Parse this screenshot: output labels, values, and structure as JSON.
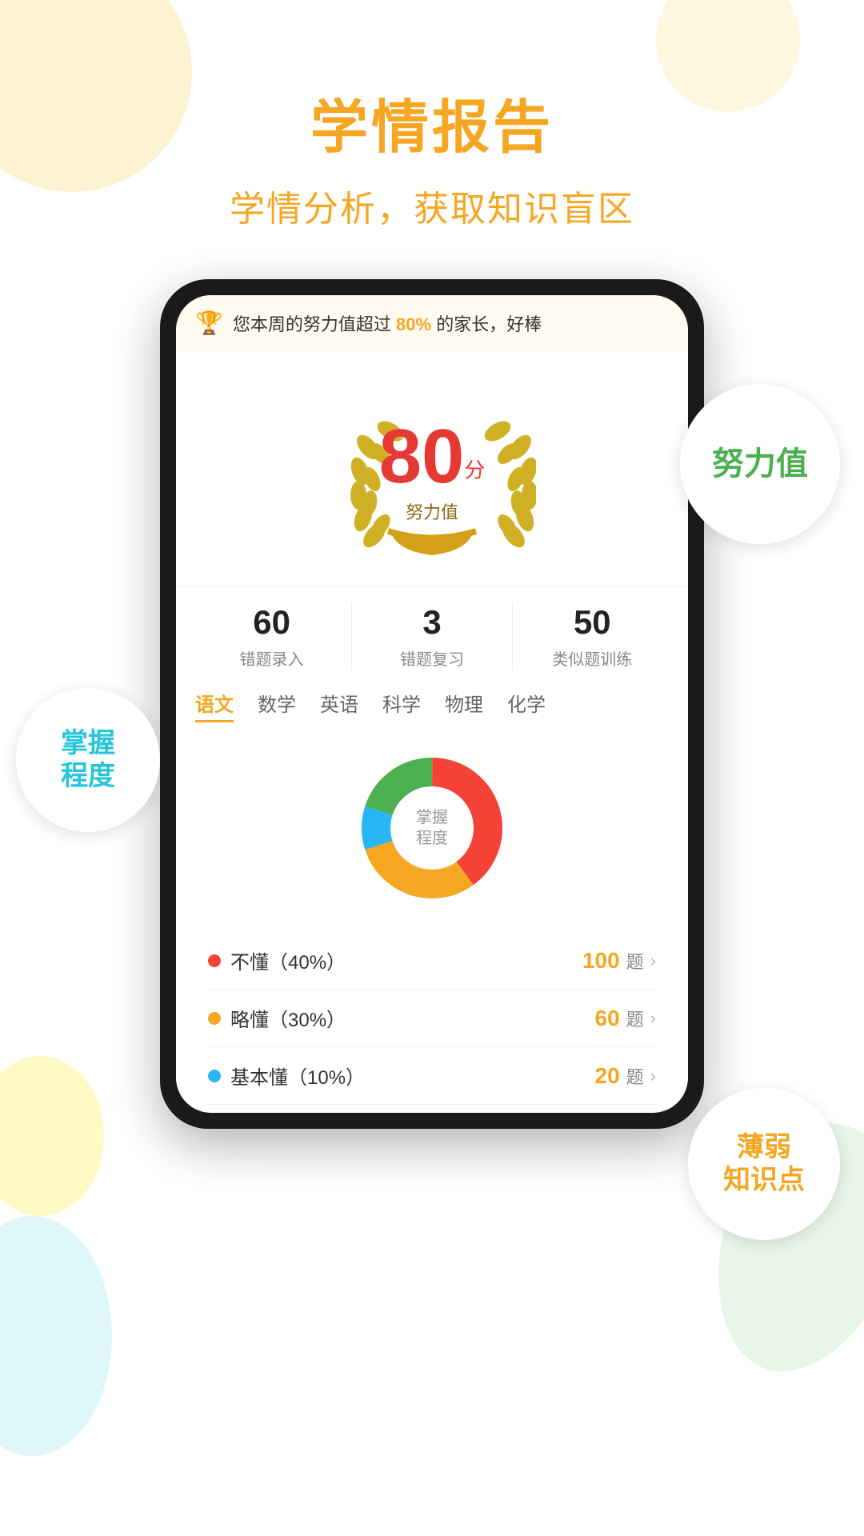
{
  "header": {
    "title": "学情报告",
    "subtitle": "学情分析，获取知识盲区"
  },
  "banner": {
    "text": "您本周的努力值超过",
    "highlight": "80%",
    "suffix": "的家长，好棒"
  },
  "effort": {
    "score": "80",
    "unit": "分",
    "label": "努力值"
  },
  "stats": [
    {
      "number": "60",
      "label": "错题录入"
    },
    {
      "number": "3",
      "label": "错题复习"
    },
    {
      "number": "50",
      "label": "类似题训练"
    }
  ],
  "subjects": [
    "语文",
    "数学",
    "英语",
    "科学",
    "物理",
    "化学"
  ],
  "active_subject": "语文",
  "chart": {
    "center_label": "掌握\n程度",
    "segments": [
      {
        "label": "不懂",
        "color": "#f44336",
        "percent": 40,
        "start": 0,
        "end": 144
      },
      {
        "label": "略懂",
        "color": "#f5a623",
        "percent": 30,
        "start": 144,
        "end": 252
      },
      {
        "label": "基本懂",
        "color": "#29b6f6",
        "percent": 10,
        "start": 252,
        "end": 288
      },
      {
        "label": "掌握",
        "color": "#4caf50",
        "percent": 20,
        "start": 288,
        "end": 360
      }
    ]
  },
  "legend": [
    {
      "text": "不懂（40%）",
      "color": "#f44336",
      "count": "100",
      "unit": "题"
    },
    {
      "text": "略懂（30%）",
      "color": "#f5a623",
      "count": "60",
      "unit": "题"
    },
    {
      "text": "基本懂（10%）",
      "color": "#29b6f6",
      "count": "20",
      "unit": "题"
    }
  ],
  "floats": {
    "effort_label": "努力值",
    "mastery_label": "掌握\n程度",
    "weak_label": "薄弱\n知识点"
  }
}
